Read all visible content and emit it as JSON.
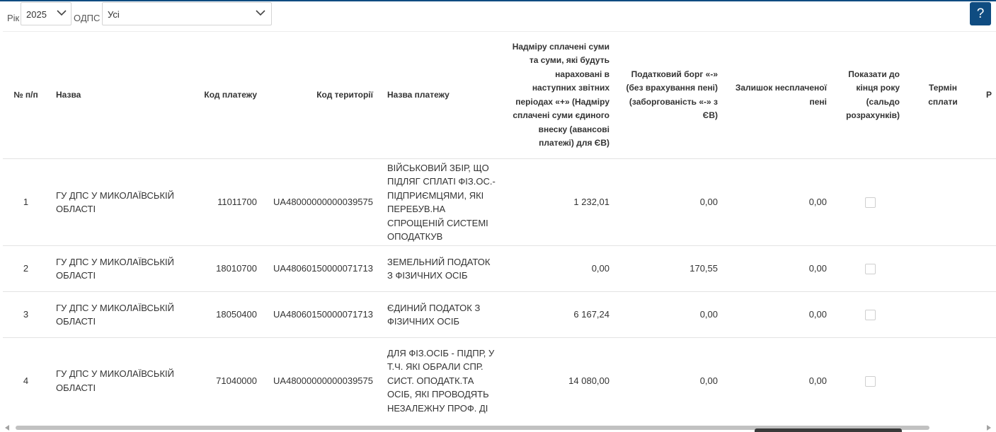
{
  "filters": {
    "year_label": "Рік",
    "year_value": "2025",
    "odps_label": "ОДПС",
    "odps_value": "Усі"
  },
  "help_label": "?",
  "table": {
    "columns": [
      "№ п/п",
      "Назва",
      "Код платежу",
      "Код території",
      "Назва платежу",
      "Надміру сплачені суми та суми, які будуть нараховані в наступних звітних періодах «+» (Надміру сплачені суми єдиного внеску (авансові платежі) для ЄВ)",
      "Податковий борг «-» (без врахування пені) (заборгованість «-» з ЄВ)",
      "Залишок несплаченої пені",
      "Показати до кінця року (сальдо розрахунків)",
      "Термін сплати",
      "Р"
    ],
    "rows": [
      {
        "num": "1",
        "name": "ГУ ДПС У МИКОЛАЇВСЬКІЙ ОБЛАСТІ",
        "pay_code": "11011700",
        "territory_code": "UA48000000000039575",
        "pay_name": "ВІЙСЬКОВИЙ ЗБІР, ЩО ПІДЛЯГ СПЛАТІ ФІЗ.ОС.-ПІДПРИЄМЦЯМИ, ЯКІ ПЕРЕБУВ.НА СПРОЩЕНІЙ СИСТЕМІ ОПОДАТКУВ",
        "overpaid": "1 232,01",
        "debt": "0,00",
        "penalty": "0,00",
        "show_to_year_end": false,
        "due_date": ""
      },
      {
        "num": "2",
        "name": "ГУ ДПС У МИКОЛАЇВСЬКІЙ ОБЛАСТІ",
        "pay_code": "18010700",
        "territory_code": "UA48060150000071713",
        "pay_name": "ЗЕМЕЛЬНИЙ ПОДАТОК З ФІЗИЧНИХ ОСІБ",
        "overpaid": "0,00",
        "debt": "170,55",
        "penalty": "0,00",
        "show_to_year_end": false,
        "due_date": ""
      },
      {
        "num": "3",
        "name": "ГУ ДПС У МИКОЛАЇВСЬКІЙ ОБЛАСТІ",
        "pay_code": "18050400",
        "territory_code": "UA48060150000071713",
        "pay_name": "ЄДИНИЙ ПОДАТОК З ФІЗИЧНИХ ОСІБ",
        "overpaid": "6 167,24",
        "debt": "0,00",
        "penalty": "0,00",
        "show_to_year_end": false,
        "due_date": ""
      },
      {
        "num": "4",
        "name": "ГУ ДПС У МИКОЛАЇВСЬКІЙ ОБЛАСТІ",
        "pay_code": "71040000",
        "territory_code": "UA48000000000039575",
        "pay_name": "ДЛЯ ФІЗ.ОСІБ - ПІДПР, У Т.Ч. ЯКІ ОБРАЛИ СПР. СИСТ. ОПОДАТК.ТА ОСІБ, ЯКІ ПРОВОДЯТЬ НЕЗАЛЕЖНУ ПРОФ. ДІ",
        "overpaid": "14 080,00",
        "debt": "0,00",
        "penalty": "0,00",
        "show_to_year_end": false,
        "due_date": ""
      }
    ]
  },
  "colors": {
    "accent": "#0f4c81",
    "border": "#e3e3e3",
    "text": "#333333"
  },
  "icons": {
    "year_select": "chevron-down-icon",
    "odps_select": "chevron-down-icon",
    "help": "question-icon"
  }
}
